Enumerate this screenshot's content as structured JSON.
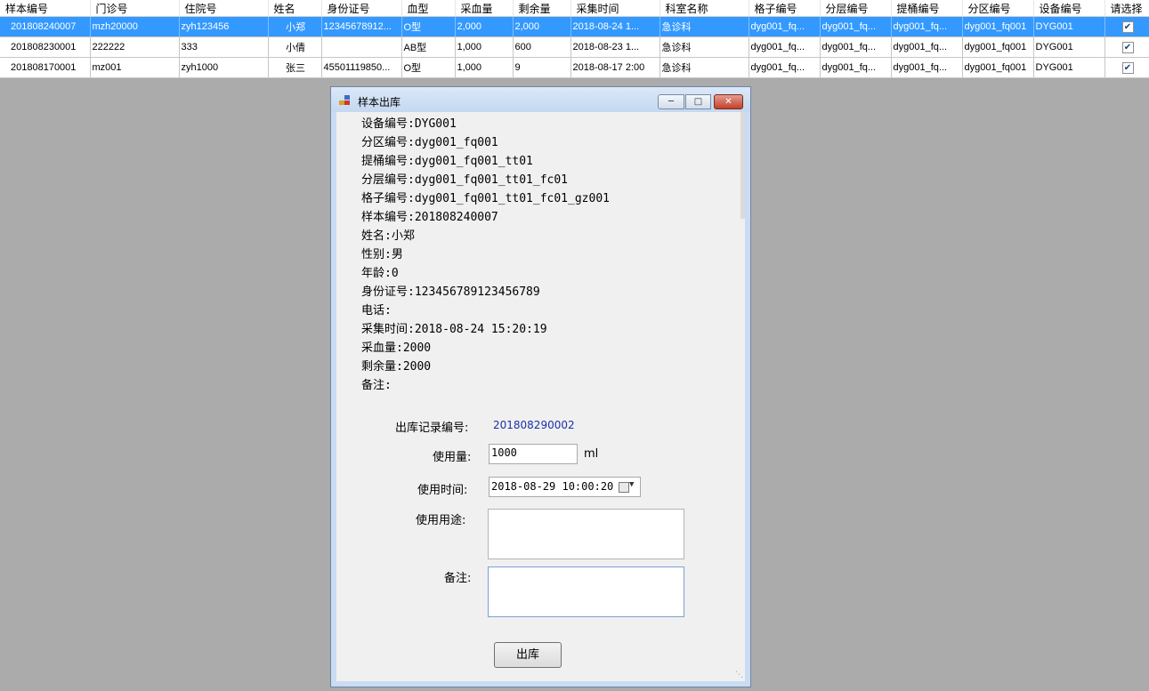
{
  "grid": {
    "columns": [
      "样本编号",
      "门诊号",
      "住院号",
      "姓名",
      "身份证号",
      "血型",
      "采血量",
      "剩余量",
      "采集时间",
      "科室名称",
      "格子编号",
      "分层编号",
      "提桶编号",
      "分区编号",
      "设备编号",
      "请选择"
    ],
    "rows": [
      [
        "201808240007",
        "mzh20000",
        "zyh123456",
        "小郑",
        "12345678912...",
        "O型",
        "2,000",
        "2,000",
        "2018-08-24 1...",
        "急诊科",
        "dyg001_fq...",
        "dyg001_fq...",
        "dyg001_fq...",
        "dyg001_fq001",
        "DYG001",
        "✔"
      ],
      [
        "201808230001",
        "222222",
        "333",
        "小倩",
        "",
        "AB型",
        "1,000",
        "600",
        "2018-08-23 1...",
        "急诊科",
        "dyg001_fq...",
        "dyg001_fq...",
        "dyg001_fq...",
        "dyg001_fq001",
        "DYG001",
        "✔"
      ],
      [
        "201808170001",
        "mz001",
        "zyh1000",
        "张三",
        "45501119850...",
        "O型",
        "1,000",
        "9",
        "2018-08-17 2:00",
        "急诊科",
        "dyg001_fq...",
        "dyg001_fq...",
        "dyg001_fq...",
        "dyg001_fq001",
        "DYG001",
        "✔"
      ]
    ],
    "selected_row": 0
  },
  "dialog": {
    "title": "样本出库",
    "min_icon": "minimize-icon",
    "max_icon": "maximize-icon",
    "close_icon": "close-icon",
    "info_lines": [
      "设备编号:DYG001",
      "分区编号:dyg001_fq001",
      "提桶编号:dyg001_fq001_tt01",
      "分层编号:dyg001_fq001_tt01_fc01",
      "格子编号:dyg001_fq001_tt01_fc01_gz001",
      "样本编号:201808240007",
      "姓名:小郑",
      "性别:男",
      "年龄:0",
      "身份证号:123456789123456789",
      "电话:",
      "采集时间:2018-08-24 15:20:19",
      "采血量:2000",
      "剩余量:2000",
      "备注:"
    ],
    "form": {
      "record_label": "出库记录编号:",
      "record_value": "201808290002",
      "usage_label": "使用量:",
      "usage_value": "1000",
      "usage_unit": "ml",
      "time_label": "使用时间:",
      "time_value": "2018-08-29 10:00:20",
      "purpose_label": "使用用途:",
      "purpose_value": "",
      "remark_label": "备注:",
      "remark_value": ""
    },
    "submit_label": "出库"
  }
}
